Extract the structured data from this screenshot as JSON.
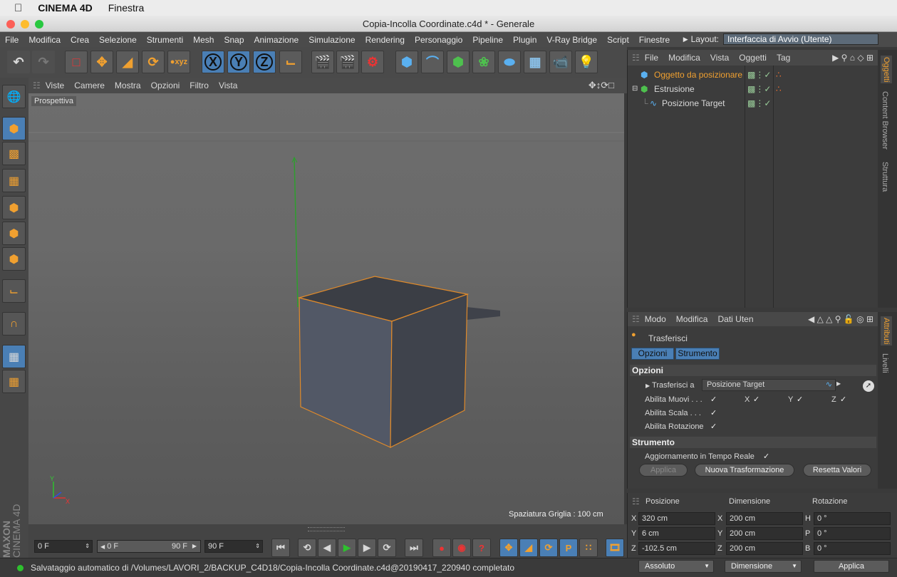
{
  "os_menu": {
    "apple": "",
    "app": "CINEMA 4D",
    "menu": "Finestra"
  },
  "window": {
    "title": "Copia-Incolla Coordinate.c4d * - Generale"
  },
  "menubar": {
    "items": [
      "File",
      "Modifica",
      "Crea",
      "Selezione",
      "Strumenti",
      "Mesh",
      "Snap",
      "Animazione",
      "Simulazione",
      "Rendering",
      "Personaggio",
      "Pipeline",
      "Plugin",
      "V-Ray Bridge",
      "Script",
      "Finestre"
    ],
    "layout_label": "Layout:",
    "layout_value": "Interfaccia di Avvio (Utente)"
  },
  "toolbar": {
    "axis_x": "X",
    "axis_y": "Y",
    "axis_z": "Z"
  },
  "viewport": {
    "menu": [
      "Viste",
      "Camere",
      "Mostra",
      "Opzioni",
      "Filtro",
      "Vista"
    ],
    "label": "Prospettiva",
    "grid_spacing": "Spaziatura Griglia : 100 cm",
    "axis_y": "Y",
    "axis_x": "X"
  },
  "timeline": {
    "start": "0 F",
    "range_start": "0 F",
    "range_end": "90 F",
    "end": "90 F"
  },
  "branding": {
    "line1": "MAXON",
    "line2": "CINEMA 4D"
  },
  "object_manager": {
    "menu": [
      "File",
      "Modifica",
      "Vista",
      "Oggetti",
      "Tag"
    ],
    "objects": [
      "Oggetto da posizionare",
      "Estrusione",
      "Posizione Target"
    ]
  },
  "side_tabs": {
    "objects": [
      "Oggetti",
      "Content Browser",
      "Struttura"
    ],
    "attributes": [
      "Attributi",
      "Livelli"
    ]
  },
  "attributes": {
    "menu": [
      "Modo",
      "Modifica",
      "Dati Uten"
    ],
    "tool_name": "Trasferisci",
    "tabs": [
      "Opzioni",
      "Strumento"
    ],
    "section_options": "Opzioni",
    "transfer_to_label": "Trasferisci a",
    "transfer_to_value": "Posizione Target",
    "enable_move": "Abilita Muovi . . .",
    "enable_scale": "Abilita Scala . . .",
    "enable_rotation": "Abilita Rotazione",
    "x": "X",
    "y": "Y",
    "z": "Z",
    "section_tool": "Strumento",
    "realtime_update": "Aggiornamento in Tempo Reale",
    "apply": "Applica",
    "new_transform": "Nuova Trasformazione",
    "reset_values": "Resetta Valori"
  },
  "coordinates": {
    "headers": [
      "Posizione",
      "Dimensione",
      "Rotazione"
    ],
    "rows": [
      {
        "l1": "X",
        "v1": "320 cm",
        "l2": "X",
        "v2": "200 cm",
        "l3": "H",
        "v3": "0 °"
      },
      {
        "l1": "Y",
        "v1": "6 cm",
        "l2": "Y",
        "v2": "200 cm",
        "l3": "P",
        "v3": "0 °"
      },
      {
        "l1": "Z",
        "v1": "-102.5 cm",
        "l2": "Z",
        "v2": "200 cm",
        "l3": "B",
        "v3": "0 °"
      }
    ],
    "mode": "Assoluto",
    "size_mode": "Dimensione",
    "apply": "Applica"
  },
  "status": {
    "message": "Salvataggio automatico di /Volumes/LAVORI_2/BACKUP_C4D18/Copia-Incolla Coordinate.c4d@20190417_220940 completato"
  },
  "colors": {
    "accent_orange": "#f0a030",
    "selection_blue": "#4a7fb5"
  }
}
